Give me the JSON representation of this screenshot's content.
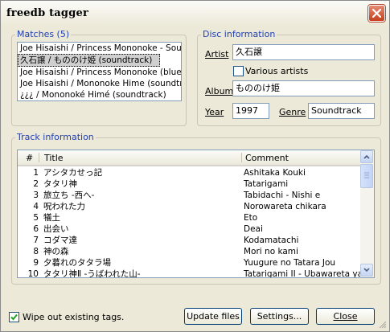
{
  "window": {
    "title": "freedb tagger"
  },
  "matches": {
    "legend": "Matches (5)",
    "items": [
      "Joe Hisaishi / Princess Mononoke - Soundtrack",
      "久石譲 / もののけ姫 (soundtrack)",
      "Joe Hisaishi / Princess Mononoke (blues)",
      "Joe Hisaishi / Mononoke Hime (soundtrack)",
      "¿¿¿ / Mononoké Himé (soundtrack)"
    ],
    "selected_index": 1
  },
  "disc": {
    "legend": "Disc information",
    "artist_label": "Artist",
    "artist_value": "久石譲",
    "various_label": "Various artists",
    "album_label": "Album",
    "album_value": "もののけ姫",
    "year_label": "Year",
    "year_value": "1997",
    "genre_label": "Genre",
    "genre_value": "Soundtrack"
  },
  "tracks": {
    "legend": "Track information",
    "headers": {
      "num": "#",
      "title": "Title",
      "comment": "Comment"
    },
    "rows": [
      {
        "num": "1",
        "title": "アシタカせっ記",
        "comment": "Ashitaka Kouki"
      },
      {
        "num": "2",
        "title": "タタリ神",
        "comment": "Tatarigami"
      },
      {
        "num": "3",
        "title": "旅立ち -西へ-",
        "comment": "Tabidachi - Nishi e"
      },
      {
        "num": "4",
        "title": "呪われた力",
        "comment": "Norowareta chikara"
      },
      {
        "num": "5",
        "title": "犠土",
        "comment": "Eto"
      },
      {
        "num": "6",
        "title": "出会い",
        "comment": "Deai"
      },
      {
        "num": "7",
        "title": "コダマ達",
        "comment": "Kodamatachi"
      },
      {
        "num": "8",
        "title": "神の森",
        "comment": "Mori no kami"
      },
      {
        "num": "9",
        "title": "夕暮れのタタラ場",
        "comment": "Yuugure no Tatara Jou"
      },
      {
        "num": "10",
        "title": "タタリ神Ⅱ -うばわれた山-",
        "comment": "Tatarigami II - Ubawareta yama"
      }
    ]
  },
  "footer": {
    "wipe_label": "Wipe out existing tags.",
    "wipe_checked": true,
    "update_label": "Update files",
    "settings_label": "Settings...",
    "close_label": "Close"
  }
}
